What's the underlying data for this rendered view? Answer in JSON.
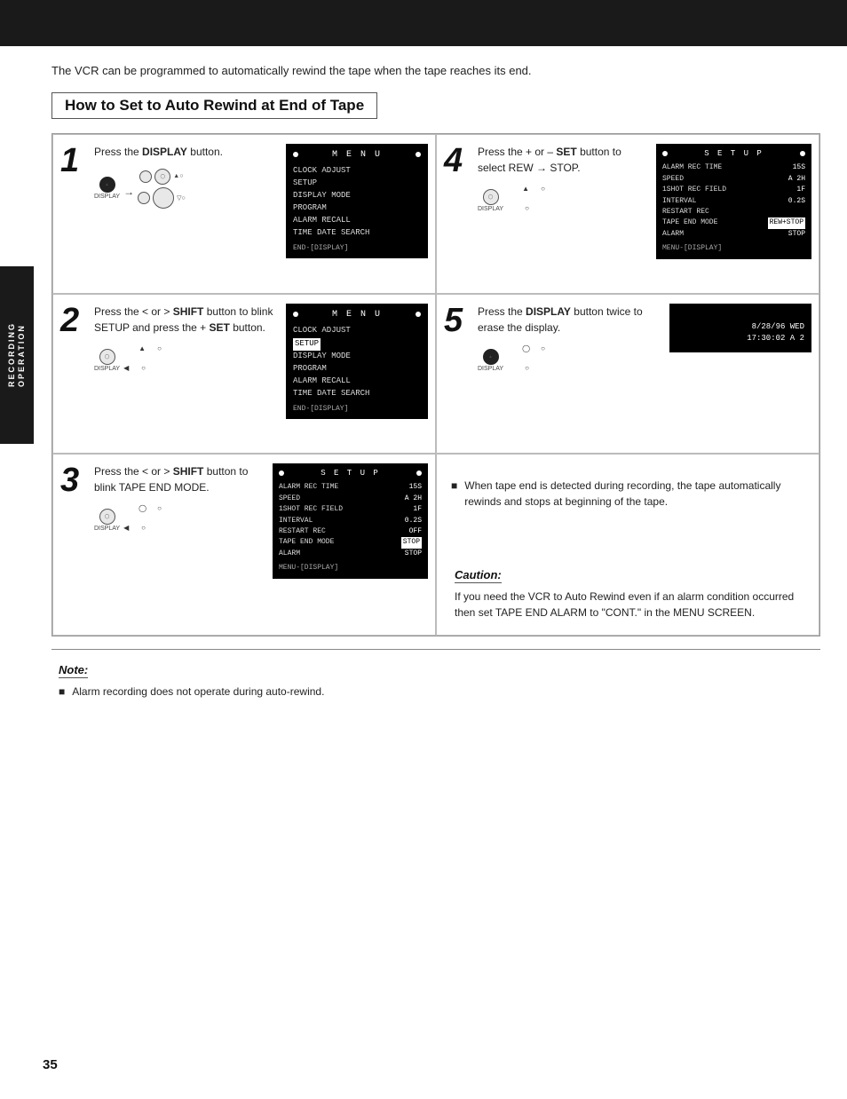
{
  "top_banner": {
    "text": ""
  },
  "side_label": {
    "line1": "RECORDING",
    "line2": "OPERATION"
  },
  "intro": {
    "text": "The VCR can be programmed to automatically rewind the tape when the tape reaches its end."
  },
  "section_title": "How to Set to Auto Rewind at End of Tape",
  "steps": [
    {
      "number": "1",
      "text": "Press the DISPLAY button.",
      "bold": "DISPLAY",
      "screen_type": "menu",
      "screen_title": "M E N U",
      "menu_items": [
        "CLOCK ADJUST",
        "SETUP",
        "DISPLAY MODE",
        "PROGRAM",
        "ALARM RECALL",
        "TIME DATE SEARCH"
      ],
      "highlighted_item": "",
      "footer": "END-[DISPLAY]"
    },
    {
      "number": "4",
      "text": "Press the + or – SET button to select REW → STOP.",
      "bold": "SET",
      "screen_type": "setup",
      "screen_title": "S E T U P",
      "setup_rows": [
        {
          "label": "ALARM REC TIME",
          "value": "15S"
        },
        {
          "label": "SPEED",
          "value": "A 2H"
        },
        {
          "label": "1SHOT REC FIELD",
          "value": "1F"
        },
        {
          "label": "INTERVAL",
          "value": "0.2S"
        },
        {
          "label": "RESTART REC",
          "value": ""
        },
        {
          "label": "TAPE END MODE",
          "value": "REW+STOP",
          "highlight": true
        },
        {
          "label": "ALARM",
          "value": "STOP"
        }
      ],
      "footer": "MENU-[DISPLAY]"
    },
    {
      "number": "2",
      "text": "Press the < or > SHIFT button to blink SETUP and press the + SET button.",
      "bold": [
        "SHIFT",
        "SET"
      ],
      "screen_type": "menu",
      "screen_title": "M E N U",
      "menu_items": [
        "CLOCK ADJUST",
        "SETUP",
        "DISPLAY MODE",
        "PROGRAM",
        "ALARM RECALL",
        "TIME DATE SEARCH"
      ],
      "highlighted_item": "SETUP",
      "footer": "END-[DISPLAY]"
    },
    {
      "number": "5",
      "text": "Press the DISPLAY button twice to erase the display.",
      "bold": "DISPLAY",
      "screen_type": "time",
      "time_line1": "8/28/96 WED",
      "time_line2": "17:30:02 A 2"
    },
    {
      "number": "3",
      "text": "Press the < or > SHIFT button to blink TAPE END MODE.",
      "bold": "SHIFT",
      "screen_type": "setup",
      "screen_title": "S E T U P",
      "setup_rows": [
        {
          "label": "ALARM REC TIME",
          "value": "15S"
        },
        {
          "label": "SPEED",
          "value": "A 2H"
        },
        {
          "label": "1SHOT REC FIELD",
          "value": "1F"
        },
        {
          "label": "INTERVAL",
          "value": "0.2S"
        },
        {
          "label": "RESTART REC",
          "value": "OFF"
        },
        {
          "label": "TAPE END MODE",
          "value": "STOP",
          "highlight": true
        },
        {
          "label": "ALARM",
          "value": "STOP"
        }
      ],
      "footer": "MENU-[DISPLAY]"
    },
    {
      "number": "",
      "text": "",
      "screen_type": "none",
      "bullet": "When tape end is detected during recording, the tape automatically rewinds and stops at beginning of the tape.",
      "caution_title": "Caution:",
      "caution_text": "If you need the VCR to Auto Rewind even if an alarm condition occurred then set TAPE END ALARM to \"CONT.\" in the MENU SCREEN."
    }
  ],
  "note": {
    "title": "Note:",
    "bullet": "Alarm recording does not operate during auto-rewind."
  },
  "page_number": "35"
}
